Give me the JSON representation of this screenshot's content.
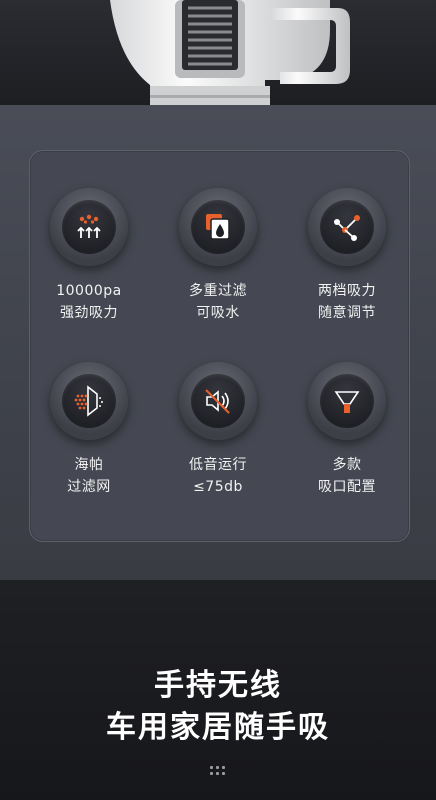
{
  "features": [
    {
      "icon": "suction-arrows-icon",
      "line1": "10000pa",
      "line2": "强劲吸力"
    },
    {
      "icon": "filter-water-icon",
      "line1": "多重过滤",
      "line2": "可吸水"
    },
    {
      "icon": "two-speed-icon",
      "line1": "两档吸力",
      "line2": "随意调节"
    },
    {
      "icon": "mesh-filter-icon",
      "line1": "海帕",
      "line2": "过滤网"
    },
    {
      "icon": "mute-speaker-icon",
      "line1": "低音运行",
      "line2": "≤75db"
    },
    {
      "icon": "nozzle-icon",
      "line1": "多款",
      "line2": "吸口配置"
    }
  ],
  "headline": {
    "line1": "手持无线",
    "line2": "车用家居随手吸"
  },
  "colors": {
    "accent": "#e8602c",
    "panel": "#454852",
    "background": "#1b1c20"
  }
}
